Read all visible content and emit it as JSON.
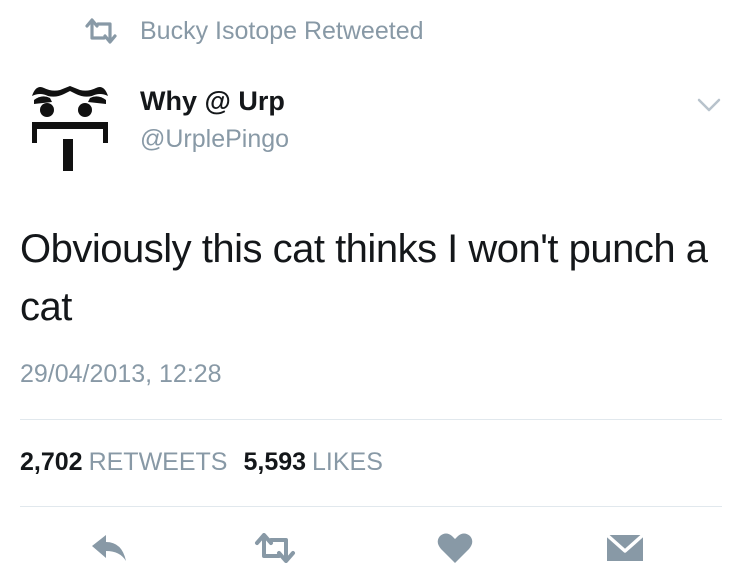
{
  "retweet_context": {
    "icon": "retweet-icon",
    "text": "Bucky Isotope Retweeted"
  },
  "author": {
    "display_name": "Why @ Urp",
    "handle": "@UrplePingo",
    "avatar": "face-avatar"
  },
  "menu": {
    "icon": "chevron-down-icon"
  },
  "tweet": {
    "text_line1": "Obviously this cat thinks I won't punch a",
    "text_line2": "cat",
    "timestamp": "29/04/2013, 12:28"
  },
  "stats": {
    "retweets_count": "2,702",
    "retweets_label": "RETWEETS",
    "likes_count": "5,593",
    "likes_label": "LIKES"
  },
  "actions": [
    {
      "icon": "reply-icon"
    },
    {
      "icon": "retweet-icon"
    },
    {
      "icon": "heart-icon"
    },
    {
      "icon": "message-icon"
    }
  ],
  "colors": {
    "text": "#14171a",
    "secondary": "#8899a6",
    "divider": "#e1e8ed"
  }
}
